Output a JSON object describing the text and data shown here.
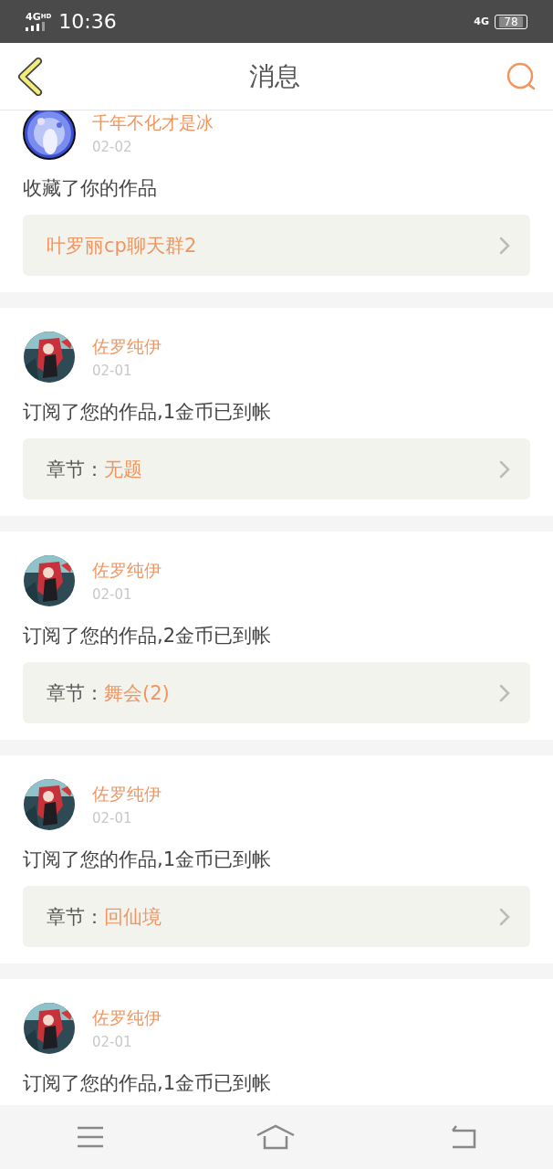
{
  "status_bar": {
    "network": "4G",
    "network_sup": "HD",
    "time": "10:36",
    "right_network": "4G",
    "battery": "78"
  },
  "header": {
    "title": "消息"
  },
  "messages": [
    {
      "user": "千年不化才是冰",
      "date": "02-02",
      "text": "收藏了你的作品",
      "link": {
        "value": "叶罗丽cp聊天群2"
      }
    },
    {
      "user": "佐罗纯伊",
      "date": "02-01",
      "text": "订阅了您的作品,1金币已到帐",
      "link": {
        "label": "章节：",
        "value": "无题"
      }
    },
    {
      "user": "佐罗纯伊",
      "date": "02-01",
      "text": "订阅了您的作品,2金币已到帐",
      "link": {
        "label": "章节：",
        "value": "舞会(2)"
      }
    },
    {
      "user": "佐罗纯伊",
      "date": "02-01",
      "text": "订阅了您的作品,1金币已到帐",
      "link": {
        "label": "章节：",
        "value": "回仙境"
      }
    },
    {
      "user": "佐罗纯伊",
      "date": "02-01",
      "text": "订阅了您的作品,1金币已到帐"
    }
  ]
}
